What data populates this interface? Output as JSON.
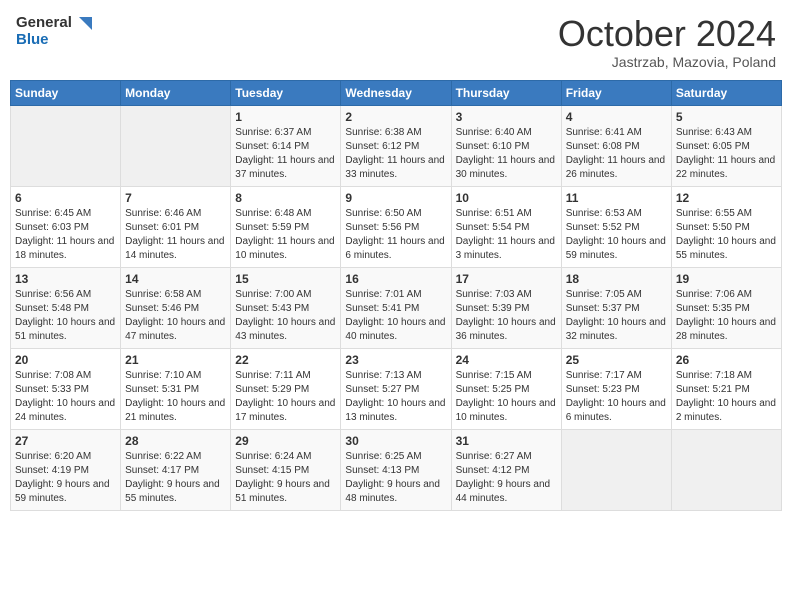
{
  "header": {
    "logo_general": "General",
    "logo_blue": "Blue",
    "month_title": "October 2024",
    "location": "Jastrzab, Mazovia, Poland"
  },
  "calendar": {
    "weekdays": [
      "Sunday",
      "Monday",
      "Tuesday",
      "Wednesday",
      "Thursday",
      "Friday",
      "Saturday"
    ],
    "rows": [
      [
        {
          "day": "",
          "empty": true
        },
        {
          "day": "",
          "empty": true
        },
        {
          "day": "1",
          "sunrise": "Sunrise: 6:37 AM",
          "sunset": "Sunset: 6:14 PM",
          "daylight": "Daylight: 11 hours and 37 minutes."
        },
        {
          "day": "2",
          "sunrise": "Sunrise: 6:38 AM",
          "sunset": "Sunset: 6:12 PM",
          "daylight": "Daylight: 11 hours and 33 minutes."
        },
        {
          "day": "3",
          "sunrise": "Sunrise: 6:40 AM",
          "sunset": "Sunset: 6:10 PM",
          "daylight": "Daylight: 11 hours and 30 minutes."
        },
        {
          "day": "4",
          "sunrise": "Sunrise: 6:41 AM",
          "sunset": "Sunset: 6:08 PM",
          "daylight": "Daylight: 11 hours and 26 minutes."
        },
        {
          "day": "5",
          "sunrise": "Sunrise: 6:43 AM",
          "sunset": "Sunset: 6:05 PM",
          "daylight": "Daylight: 11 hours and 22 minutes."
        }
      ],
      [
        {
          "day": "6",
          "sunrise": "Sunrise: 6:45 AM",
          "sunset": "Sunset: 6:03 PM",
          "daylight": "Daylight: 11 hours and 18 minutes."
        },
        {
          "day": "7",
          "sunrise": "Sunrise: 6:46 AM",
          "sunset": "Sunset: 6:01 PM",
          "daylight": "Daylight: 11 hours and 14 minutes."
        },
        {
          "day": "8",
          "sunrise": "Sunrise: 6:48 AM",
          "sunset": "Sunset: 5:59 PM",
          "daylight": "Daylight: 11 hours and 10 minutes."
        },
        {
          "day": "9",
          "sunrise": "Sunrise: 6:50 AM",
          "sunset": "Sunset: 5:56 PM",
          "daylight": "Daylight: 11 hours and 6 minutes."
        },
        {
          "day": "10",
          "sunrise": "Sunrise: 6:51 AM",
          "sunset": "Sunset: 5:54 PM",
          "daylight": "Daylight: 11 hours and 3 minutes."
        },
        {
          "day": "11",
          "sunrise": "Sunrise: 6:53 AM",
          "sunset": "Sunset: 5:52 PM",
          "daylight": "Daylight: 10 hours and 59 minutes."
        },
        {
          "day": "12",
          "sunrise": "Sunrise: 6:55 AM",
          "sunset": "Sunset: 5:50 PM",
          "daylight": "Daylight: 10 hours and 55 minutes."
        }
      ],
      [
        {
          "day": "13",
          "sunrise": "Sunrise: 6:56 AM",
          "sunset": "Sunset: 5:48 PM",
          "daylight": "Daylight: 10 hours and 51 minutes."
        },
        {
          "day": "14",
          "sunrise": "Sunrise: 6:58 AM",
          "sunset": "Sunset: 5:46 PM",
          "daylight": "Daylight: 10 hours and 47 minutes."
        },
        {
          "day": "15",
          "sunrise": "Sunrise: 7:00 AM",
          "sunset": "Sunset: 5:43 PM",
          "daylight": "Daylight: 10 hours and 43 minutes."
        },
        {
          "day": "16",
          "sunrise": "Sunrise: 7:01 AM",
          "sunset": "Sunset: 5:41 PM",
          "daylight": "Daylight: 10 hours and 40 minutes."
        },
        {
          "day": "17",
          "sunrise": "Sunrise: 7:03 AM",
          "sunset": "Sunset: 5:39 PM",
          "daylight": "Daylight: 10 hours and 36 minutes."
        },
        {
          "day": "18",
          "sunrise": "Sunrise: 7:05 AM",
          "sunset": "Sunset: 5:37 PM",
          "daylight": "Daylight: 10 hours and 32 minutes."
        },
        {
          "day": "19",
          "sunrise": "Sunrise: 7:06 AM",
          "sunset": "Sunset: 5:35 PM",
          "daylight": "Daylight: 10 hours and 28 minutes."
        }
      ],
      [
        {
          "day": "20",
          "sunrise": "Sunrise: 7:08 AM",
          "sunset": "Sunset: 5:33 PM",
          "daylight": "Daylight: 10 hours and 24 minutes."
        },
        {
          "day": "21",
          "sunrise": "Sunrise: 7:10 AM",
          "sunset": "Sunset: 5:31 PM",
          "daylight": "Daylight: 10 hours and 21 minutes."
        },
        {
          "day": "22",
          "sunrise": "Sunrise: 7:11 AM",
          "sunset": "Sunset: 5:29 PM",
          "daylight": "Daylight: 10 hours and 17 minutes."
        },
        {
          "day": "23",
          "sunrise": "Sunrise: 7:13 AM",
          "sunset": "Sunset: 5:27 PM",
          "daylight": "Daylight: 10 hours and 13 minutes."
        },
        {
          "day": "24",
          "sunrise": "Sunrise: 7:15 AM",
          "sunset": "Sunset: 5:25 PM",
          "daylight": "Daylight: 10 hours and 10 minutes."
        },
        {
          "day": "25",
          "sunrise": "Sunrise: 7:17 AM",
          "sunset": "Sunset: 5:23 PM",
          "daylight": "Daylight: 10 hours and 6 minutes."
        },
        {
          "day": "26",
          "sunrise": "Sunrise: 7:18 AM",
          "sunset": "Sunset: 5:21 PM",
          "daylight": "Daylight: 10 hours and 2 minutes."
        }
      ],
      [
        {
          "day": "27",
          "sunrise": "Sunrise: 6:20 AM",
          "sunset": "Sunset: 4:19 PM",
          "daylight": "Daylight: 9 hours and 59 minutes."
        },
        {
          "day": "28",
          "sunrise": "Sunrise: 6:22 AM",
          "sunset": "Sunset: 4:17 PM",
          "daylight": "Daylight: 9 hours and 55 minutes."
        },
        {
          "day": "29",
          "sunrise": "Sunrise: 6:24 AM",
          "sunset": "Sunset: 4:15 PM",
          "daylight": "Daylight: 9 hours and 51 minutes."
        },
        {
          "day": "30",
          "sunrise": "Sunrise: 6:25 AM",
          "sunset": "Sunset: 4:13 PM",
          "daylight": "Daylight: 9 hours and 48 minutes."
        },
        {
          "day": "31",
          "sunrise": "Sunrise: 6:27 AM",
          "sunset": "Sunset: 4:12 PM",
          "daylight": "Daylight: 9 hours and 44 minutes."
        },
        {
          "day": "",
          "empty": true
        },
        {
          "day": "",
          "empty": true
        }
      ]
    ]
  }
}
